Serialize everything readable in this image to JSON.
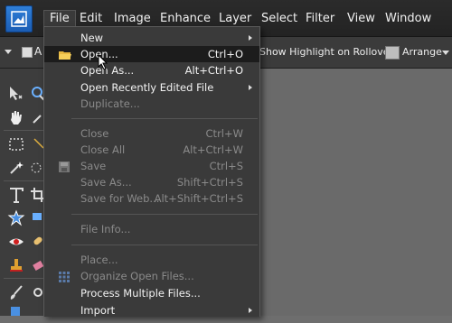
{
  "menubar": {
    "items": [
      "File",
      "Edit",
      "Image",
      "Enhance",
      "Layer",
      "Select",
      "Filter",
      "View",
      "Window"
    ],
    "active": "File"
  },
  "options": {
    "check_label": "A",
    "show_highlight": "Show Highlight on Rollover",
    "arrange_label": "Arrange"
  },
  "file_menu": {
    "items": [
      {
        "label": "New",
        "shortcut": "",
        "submenu": true,
        "enabled": true
      },
      {
        "label": "Open...",
        "shortcut": "Ctrl+O",
        "submenu": false,
        "enabled": true,
        "highlighted": true,
        "icon": "folder-icon"
      },
      {
        "label": "Open As...",
        "shortcut": "Alt+Ctrl+O",
        "submenu": false,
        "enabled": true
      },
      {
        "label": "Open Recently Edited File",
        "shortcut": "",
        "submenu": true,
        "enabled": true
      },
      {
        "label": "Duplicate...",
        "shortcut": "",
        "submenu": false,
        "enabled": false
      },
      {
        "label": "Close",
        "shortcut": "Ctrl+W",
        "submenu": false,
        "enabled": false
      },
      {
        "label": "Close All",
        "shortcut": "Alt+Ctrl+W",
        "submenu": false,
        "enabled": false
      },
      {
        "label": "Save",
        "shortcut": "Ctrl+S",
        "submenu": false,
        "enabled": false,
        "icon": "floppy-icon"
      },
      {
        "label": "Save As...",
        "shortcut": "Shift+Ctrl+S",
        "submenu": false,
        "enabled": false
      },
      {
        "label": "Save for Web...",
        "shortcut": "Alt+Shift+Ctrl+S",
        "submenu": false,
        "enabled": false
      },
      {
        "label": "File Info...",
        "shortcut": "",
        "submenu": false,
        "enabled": false
      },
      {
        "label": "Place...",
        "shortcut": "",
        "submenu": false,
        "enabled": false
      },
      {
        "label": "Organize Open Files...",
        "shortcut": "",
        "submenu": false,
        "enabled": false,
        "icon": "grid-icon"
      },
      {
        "label": "Process Multiple Files...",
        "shortcut": "",
        "submenu": false,
        "enabled": true
      },
      {
        "label": "Import",
        "shortcut": "",
        "submenu": true,
        "enabled": true
      }
    ]
  },
  "colors": {
    "menubar": "#262626",
    "menu_bg": "#3a3a3a",
    "highlight": "#1c1c1c",
    "canvas": "#6a6a6a",
    "disabled_text": "#8a8a8a"
  }
}
